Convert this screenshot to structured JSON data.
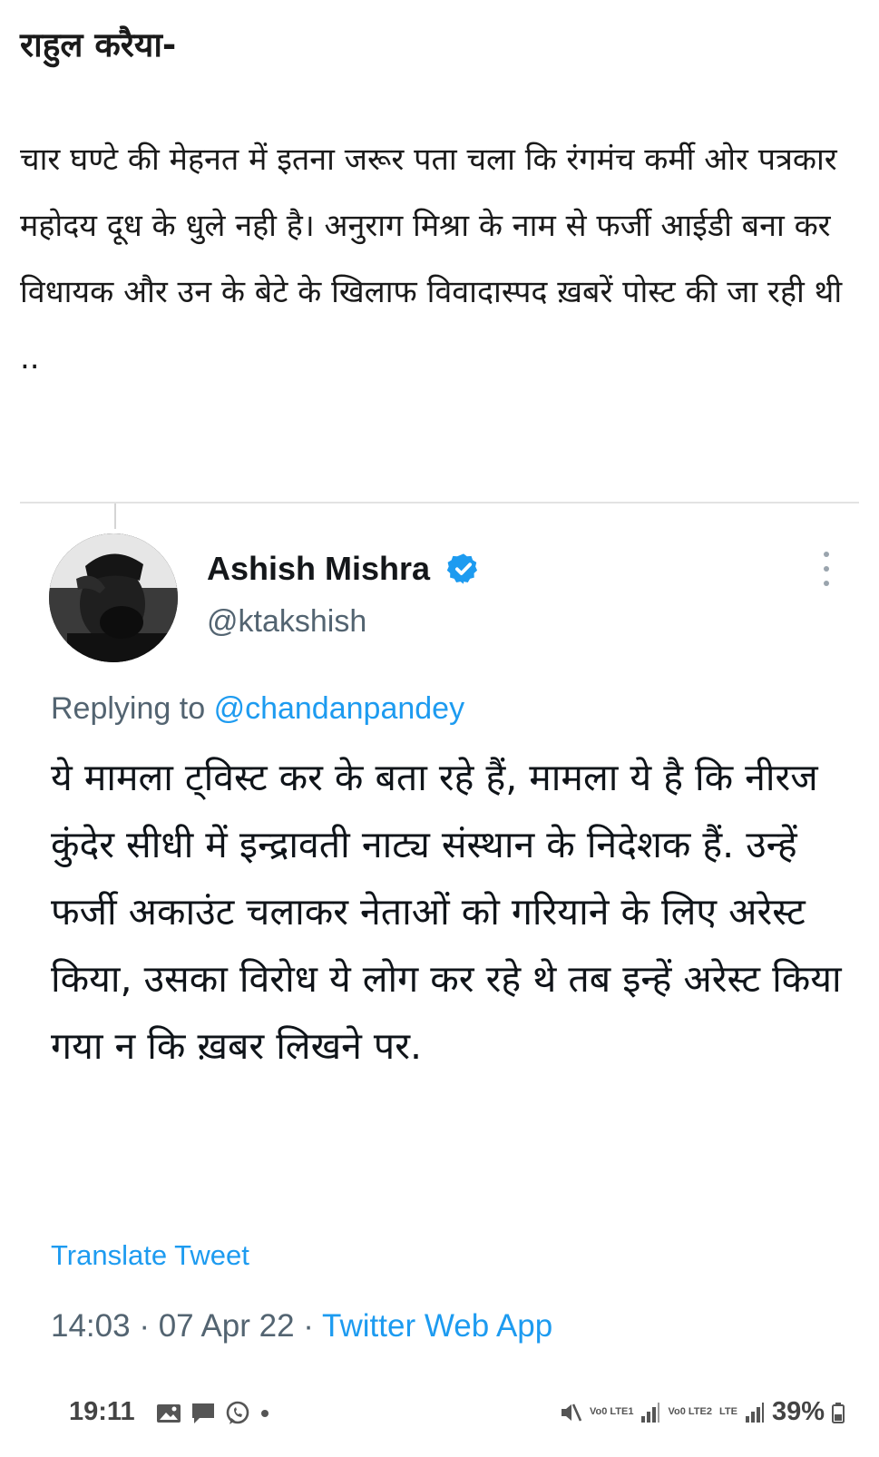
{
  "post": {
    "author": "राहुल करैया-",
    "body": "चार घण्टे की मेहनत में इतना जरूर पता चला कि रंगमंच कर्मी ओर पत्रकार महोदय दूध के धुले नही है। अनुराग मिश्रा के नाम से फर्जी आईडी बना कर विधायक और उन के बेटे के खिलाफ विवादास्पद ख़बरें पोस्ट की जा रही थी .."
  },
  "tweet": {
    "display_name": "Ashish Mishra",
    "handle": "@ktakshish",
    "replying_prefix": "Replying to",
    "replying_to": "@chandanpandey",
    "text": "ये मामला ट्विस्ट कर के बता रहे हैं, मामला ये है कि नीरज कुंदेर सीधी में इन्द्रावती नाट्य संस्थान के निदेशक हैं. उन्हें फर्जी अकाउंट चलाकर नेताओं को गरियाने के लिए अरेस्ट किया, उसका विरोध ये लोग कर रहे थे तब इन्हें अरेस्ट किया गया न कि ख़बर लिखने पर.",
    "translate_label": "Translate Tweet",
    "time": "14:03",
    "separator": "·",
    "date": "07 Apr 22",
    "source": "Twitter Web App",
    "verified_icon": "verified-badge-icon",
    "more_icon": "more-vertical-icon"
  },
  "status_bar": {
    "time": "19:11",
    "net_label_1": "Vo0 LTE1",
    "net_label_2": "Vo0 LTE2",
    "lte": "LTE",
    "battery": "39%",
    "icons": [
      "image-icon",
      "message-icon",
      "whatsapp-icon",
      "dot-icon",
      "mute-icon",
      "signal-icon",
      "battery-icon"
    ]
  },
  "colors": {
    "twitter_blue": "#1d9bf0",
    "secondary_text": "#536471",
    "primary_text": "#0f1419"
  }
}
